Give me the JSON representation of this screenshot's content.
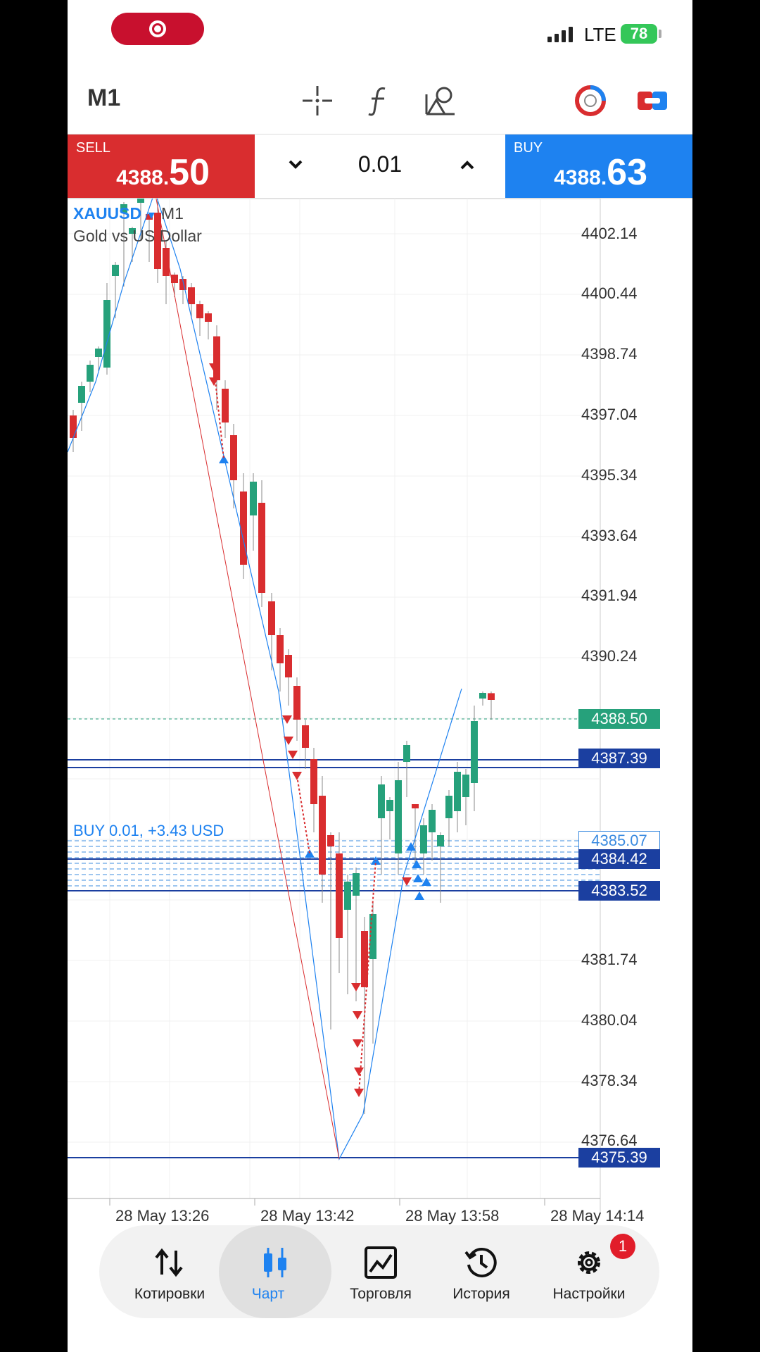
{
  "status_bar": {
    "network": "LTE",
    "battery": "78"
  },
  "toolbar": {
    "timeframe": "M1"
  },
  "trade": {
    "sell_label": "SELL",
    "sell_price_prefix": "4388.",
    "sell_price_suffix": "50",
    "buy_label": "BUY",
    "buy_price_prefix": "4388.",
    "buy_price_suffix": "63",
    "lot": "0.01"
  },
  "chart": {
    "symbol": "XAUUSD",
    "symbol_timeframe": "M1",
    "description": "Gold vs US Dollar",
    "y_ticks": [
      "4402.14",
      "4400.44",
      "4398.74",
      "4397.04",
      "4395.34",
      "4393.64",
      "4391.94",
      "4390.24",
      "4381.74",
      "4380.04",
      "4378.34",
      "4376.64"
    ],
    "x_ticks": [
      "28 May 13:26",
      "28 May 13:42",
      "28 May 13:58",
      "28 May 14:14"
    ],
    "bid_tag": "4388.50",
    "level_tags": {
      "l1": "4387.39",
      "l2": "4385.07",
      "l3": "4384.42",
      "l4": "4383.52",
      "low": "4375.39"
    },
    "position_label": "BUY 0.01, +3.43 USD"
  },
  "nav": {
    "quotes": "Котировки",
    "chart": "Чарт",
    "trade": "Торговля",
    "history": "История",
    "settings": "Настройки",
    "settings_badge": "1"
  },
  "colors": {
    "sell": "#d92d2f",
    "buy": "#1e82f0",
    "bull": "#26a17b",
    "bear": "#d92d2f"
  }
}
